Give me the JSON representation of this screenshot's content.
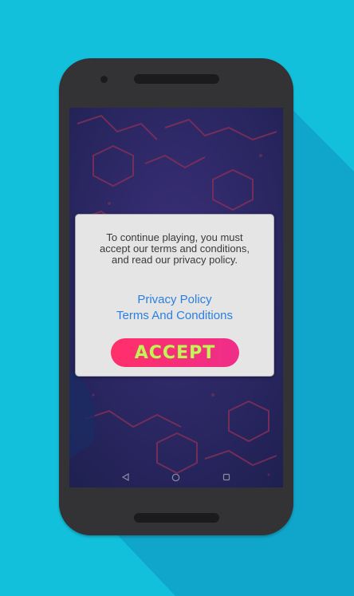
{
  "dialog": {
    "message": "To continue playing, you must\naccept our terms and conditions,\nand read our privacy policy.",
    "privacy_link": "Privacy Policy",
    "terms_link": "Terms And Conditions",
    "accept_label": "ACCEPT"
  },
  "navbar": {
    "back_icon": "back-triangle-icon",
    "home_icon": "home-circle-icon",
    "recents_icon": "recents-square-icon"
  },
  "colors": {
    "background": "#13c0dc",
    "phone_body": "#333335",
    "link": "#2b7fe0",
    "accept_gradient_start": "#ff2f6a",
    "accept_gradient_end": "#ef2e8a",
    "accept_text": "#c8f05a"
  }
}
